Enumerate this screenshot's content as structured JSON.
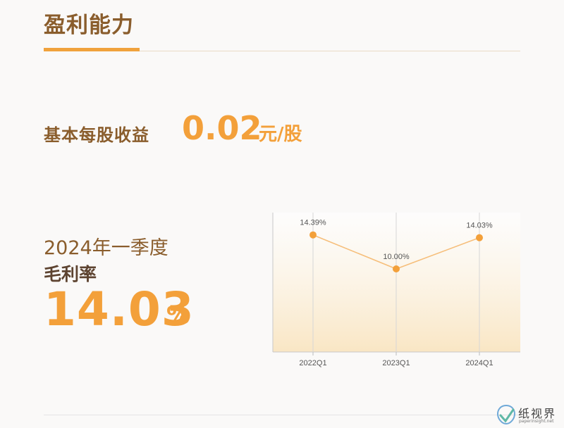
{
  "section": {
    "title": "盈利能力"
  },
  "eps": {
    "label": "基本每股收益",
    "value": "0.02",
    "unit": "元/股"
  },
  "gross_margin": {
    "period": "2024年一季度",
    "label": "毛利率",
    "value": "14.03",
    "unit": "%"
  },
  "watermark": {
    "title": "纸视界",
    "subtitle": "paperinsight.net"
  },
  "colors": {
    "brand_brown": "#8a5d2c",
    "accent_orange": "#f3a03a",
    "line": "#f6be7a"
  },
  "chart_data": {
    "type": "line",
    "categories": [
      "2022Q1",
      "2023Q1",
      "2024Q1"
    ],
    "values": [
      14.39,
      10.0,
      14.03
    ],
    "labels": [
      "14.39%",
      "10.00%",
      "14.03%"
    ],
    "ylim": [
      0,
      18
    ],
    "grid": "vertical"
  }
}
